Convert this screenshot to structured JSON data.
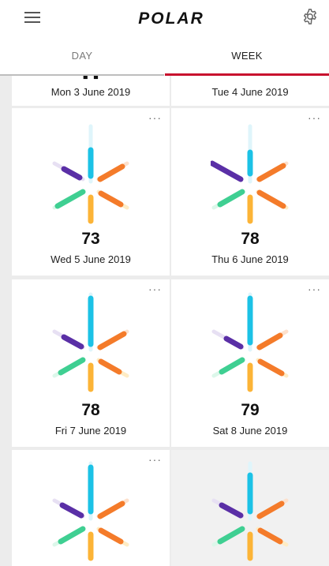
{
  "app": {
    "logo_text": "POLAR"
  },
  "icons": {
    "menu": "hamburger-menu-icon",
    "settings": "gear-icon",
    "more": "more-dots-icon"
  },
  "tabs": [
    {
      "label": "DAY",
      "active": false
    },
    {
      "label": "WEEK",
      "active": true
    }
  ],
  "colors": {
    "accent_red": "#c8102e",
    "cyan": "#1cc2e6",
    "orange": "#f47b2a",
    "yellow": "#fcb437",
    "purple": "#5a2fa6",
    "green": "#3fcf92"
  },
  "cards": [
    {
      "date": "Mon 3 June 2019",
      "score": ""
    },
    {
      "date": "Tue 4 June 2019",
      "score": ""
    },
    {
      "date": "Wed 5 June 2019",
      "score": "73",
      "more": "···"
    },
    {
      "date": "Thu 6 June 2019",
      "score": "78",
      "more": "···"
    },
    {
      "date": "Fri 7 June 2019",
      "score": "78",
      "more": "···"
    },
    {
      "date": "Sat 8 June 2019",
      "score": "79",
      "more": "···"
    },
    {
      "date": "",
      "score": "",
      "more": "···"
    },
    {
      "date": "",
      "score": "",
      "more": ""
    }
  ]
}
